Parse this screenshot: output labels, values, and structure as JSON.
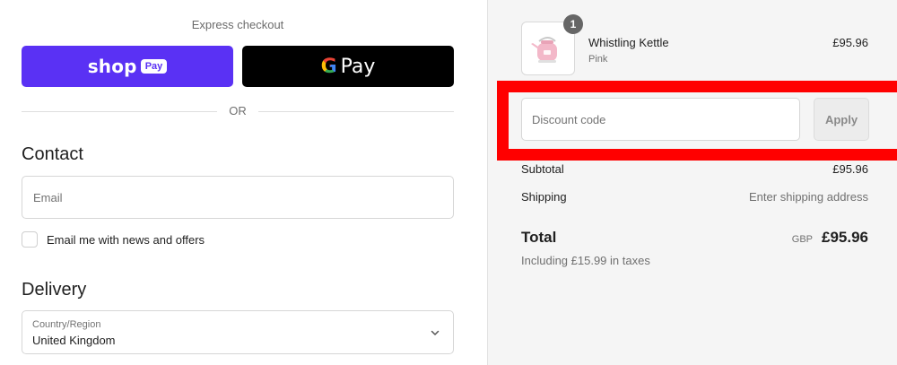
{
  "express": {
    "title": "Express checkout",
    "shop_pay": {
      "word": "shop",
      "badge": "Pay"
    },
    "google_pay": {
      "g": "G",
      "word": "Pay"
    },
    "or": "OR"
  },
  "contact": {
    "heading": "Contact",
    "email_placeholder": "Email",
    "email_value": "",
    "newsletter_label": "Email me with news and offers",
    "newsletter_checked": false
  },
  "delivery": {
    "heading": "Delivery",
    "country_label": "Country/Region",
    "country_value": "United Kingdom"
  },
  "order": {
    "item": {
      "quantity": "1",
      "name": "Whistling Kettle",
      "variant": "Pink",
      "price": "£95.96",
      "thumbnail_icon": "pink-kettle-icon"
    },
    "discount": {
      "placeholder": "Discount code",
      "value": "",
      "apply_label": "Apply"
    },
    "subtotal": {
      "label": "Subtotal",
      "value": "£95.96"
    },
    "shipping": {
      "label": "Shipping",
      "value": "Enter shipping address"
    },
    "total": {
      "label": "Total",
      "currency": "GBP",
      "value": "£95.96",
      "taxes_note": "Including £15.99 in taxes"
    }
  },
  "colors": {
    "shop_pay": "#5a31f4",
    "google_pay": "#000000",
    "highlight": "#ff0000",
    "summary_bg": "#f5f5f5"
  }
}
